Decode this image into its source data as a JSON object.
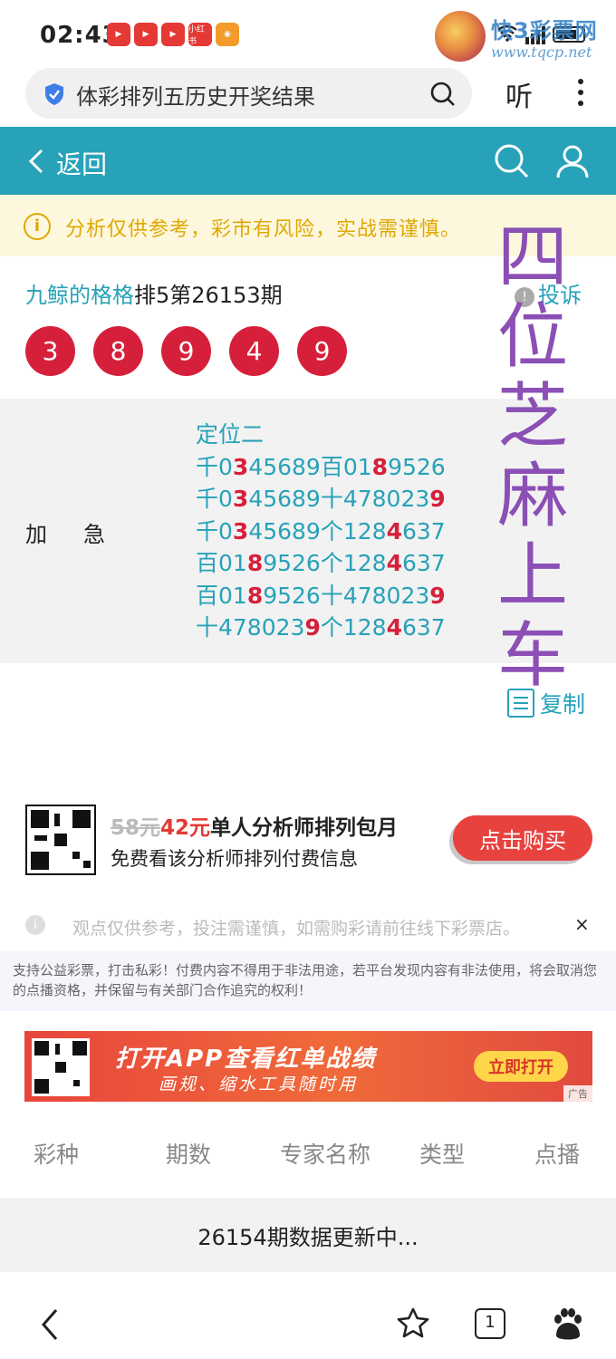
{
  "status_bar": {
    "time": "02:43",
    "app_icons": [
      "",
      "",
      "",
      "小红书",
      ""
    ]
  },
  "watermark": {
    "text": "快3彩票网",
    "url": "www.tqcp.net"
  },
  "browser": {
    "search_text": "体彩排列五历史开奖结果",
    "listen_label": "听"
  },
  "app_bar": {
    "back_label": "返回"
  },
  "notice": {
    "icon": "i",
    "text": "分析仅供参考，彩市有风险，实战需谨慎。"
  },
  "overlay_title": [
    "四",
    "位",
    "芝",
    "麻",
    "上",
    "车"
  ],
  "post": {
    "author": "九鲸的格格",
    "period": "排5第26153期",
    "complain_label": "投诉",
    "balls": [
      "3",
      "8",
      "9",
      "4",
      "9"
    ]
  },
  "plan": {
    "label": "加急",
    "heading": "定位二",
    "lines": [
      {
        "pre": "千0",
        "hl": "3",
        "mid": "45689百01",
        "hl2": "8",
        "post": "9526"
      },
      {
        "pre": "千0",
        "hl": "3",
        "mid": "45689十478023",
        "hl2": "9",
        "post": ""
      },
      {
        "pre": "千0",
        "hl": "3",
        "mid": "45689个128",
        "hl2": "4",
        "post": "637"
      },
      {
        "pre": "百01",
        "hl": "8",
        "mid": "9526个128",
        "hl2": "4",
        "post": "637"
      },
      {
        "pre": "百01",
        "hl": "8",
        "mid": "9526十478023",
        "hl2": "9",
        "post": ""
      },
      {
        "pre": "十478023",
        "hl": "9",
        "mid": "个128",
        "hl2": "4",
        "post": "637"
      }
    ]
  },
  "copy_label": "复制",
  "promo": {
    "old_price": "58元",
    "new_price": "42元",
    "title": "单人分析师排列包月",
    "subtitle": "免费看该分析师排列付费信息",
    "buy_label": "点击购买"
  },
  "tip": {
    "text": "观点仅供参考，投注需谨慎，如需购彩请前往线下彩票店。",
    "close": "×"
  },
  "legal": "支持公益彩票，打击私彩！付费内容不得用于非法用途，若平台发现内容有非法使用，将会取消您的点播资格，并保留与有关部门合作追究的权利！",
  "banner": {
    "title": "打开APP查看红单战绩",
    "subtitle": "画规、缩水工具随时用",
    "button": "立即打开",
    "ad_tag": "广告"
  },
  "table": {
    "headers": [
      "彩种",
      "期数",
      "专家名称",
      "类型",
      "点播"
    ],
    "status": "26154期数据更新中..."
  },
  "nav": {
    "tab_count": "1"
  },
  "colors": {
    "teal": "#27a2b9",
    "red": "#d6203b",
    "purple": "#8b4fb5",
    "notice_yellow": "#e0a800"
  }
}
